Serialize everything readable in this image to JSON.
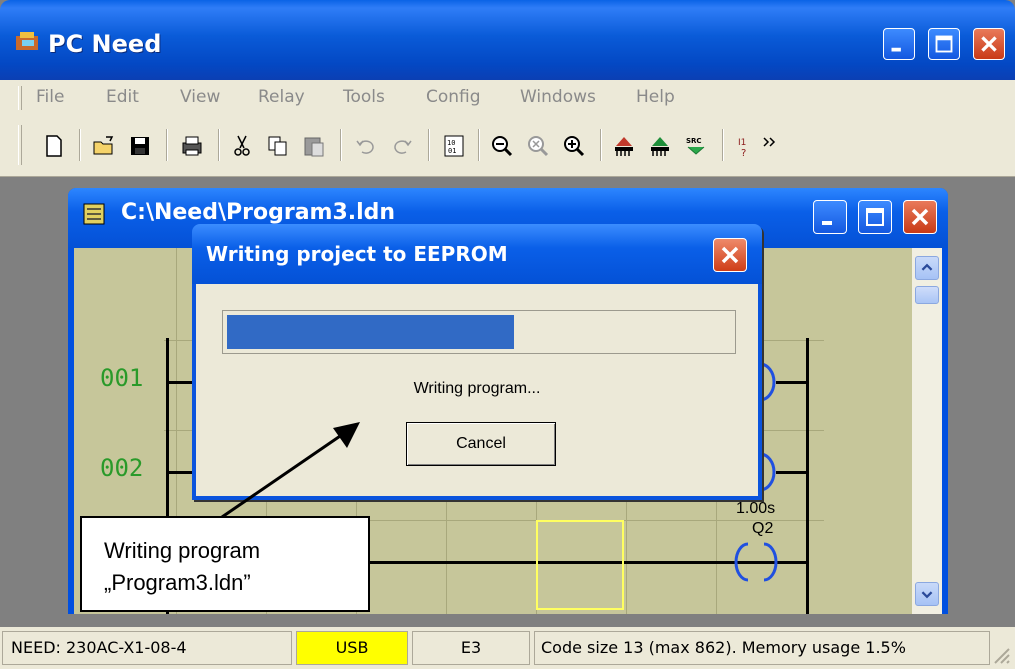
{
  "app": {
    "title": "PC Need"
  },
  "menu": [
    "File",
    "Edit",
    "View",
    "Relay",
    "Tools",
    "Config",
    "Windows",
    "Help"
  ],
  "toolbar_icons": [
    "new-file-icon",
    "open-folder-icon",
    "save-icon",
    "print-icon",
    "cut-icon",
    "copy-icon",
    "paste-icon",
    "undo-icon",
    "redo-icon",
    "binary-code-icon",
    "zoom-out-icon",
    "zoom-reset-icon",
    "zoom-in-icon",
    "download-icon",
    "upload-icon",
    "source-code-icon",
    "input-query-icon"
  ],
  "child_window": {
    "title": "C:\\Need\\Program3.ldn"
  },
  "ladder": {
    "rungs": [
      "001",
      "002"
    ],
    "timer_label": "1.00s",
    "coil_label": "Q2"
  },
  "dialog": {
    "title": "Writing project to EEPROM",
    "progress": 0.57,
    "status": "Writing program...",
    "cancel_label": "Cancel"
  },
  "callout": {
    "line1": "Writing program",
    "line2": "„Program3.ldn”"
  },
  "statusbar": {
    "device": "NEED: 230AC-X1-08-4",
    "connection": "USB",
    "code": "E3",
    "info": "Code size 13 (max 862). Memory usage 1.5%"
  },
  "colors": {
    "title_blue": "#0a5fe8",
    "usb_highlight": "#ffff00",
    "progress_fill": "#316ac5",
    "rung_green": "#2a9a2a"
  }
}
